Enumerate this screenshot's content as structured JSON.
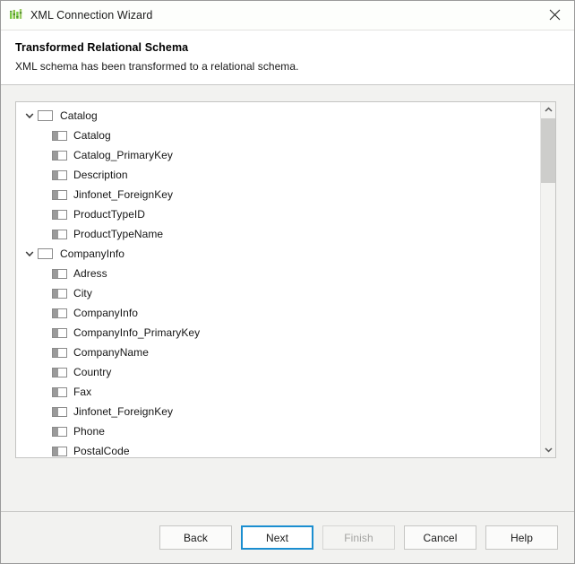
{
  "window": {
    "title": "XML Connection Wizard",
    "icon": "bar-chart-icon",
    "close_icon": "close-icon",
    "accent_color": "#1b8ed0",
    "icon_color": "#4caf50"
  },
  "header": {
    "title": "Transformed Relational Schema",
    "subtitle": "XML schema has been transformed to a relational schema."
  },
  "tree": {
    "nodes": [
      {
        "label": "Catalog",
        "type": "table",
        "expanded": true,
        "chevron_icon": "chevron-down-icon",
        "icon": "table-icon",
        "children": [
          {
            "label": "Catalog",
            "icon": "column-icon"
          },
          {
            "label": "Catalog_PrimaryKey",
            "icon": "column-icon"
          },
          {
            "label": "Description",
            "icon": "column-icon"
          },
          {
            "label": "Jinfonet_ForeignKey",
            "icon": "column-icon"
          },
          {
            "label": "ProductTypeID",
            "icon": "column-icon"
          },
          {
            "label": "ProductTypeName",
            "icon": "column-icon"
          }
        ]
      },
      {
        "label": "CompanyInfo",
        "type": "table",
        "expanded": true,
        "chevron_icon": "chevron-down-icon",
        "icon": "table-icon",
        "children": [
          {
            "label": "Adress",
            "icon": "column-icon"
          },
          {
            "label": "City",
            "icon": "column-icon"
          },
          {
            "label": "CompanyInfo",
            "icon": "column-icon"
          },
          {
            "label": "CompanyInfo_PrimaryKey",
            "icon": "column-icon"
          },
          {
            "label": "CompanyName",
            "icon": "column-icon"
          },
          {
            "label": "Country",
            "icon": "column-icon"
          },
          {
            "label": "Fax",
            "icon": "column-icon"
          },
          {
            "label": "Jinfonet_ForeignKey",
            "icon": "column-icon"
          },
          {
            "label": "Phone",
            "icon": "column-icon"
          },
          {
            "label": "PostalCode",
            "icon": "column-icon"
          }
        ]
      }
    ],
    "scrollbar": {
      "up_icon": "chevron-up-icon",
      "down_icon": "chevron-down-icon"
    }
  },
  "footer": {
    "buttons": [
      {
        "label": "Back",
        "state": "normal"
      },
      {
        "label": "Next",
        "state": "focused"
      },
      {
        "label": "Finish",
        "state": "disabled"
      },
      {
        "label": "Cancel",
        "state": "normal"
      },
      {
        "label": "Help",
        "state": "normal"
      }
    ]
  }
}
